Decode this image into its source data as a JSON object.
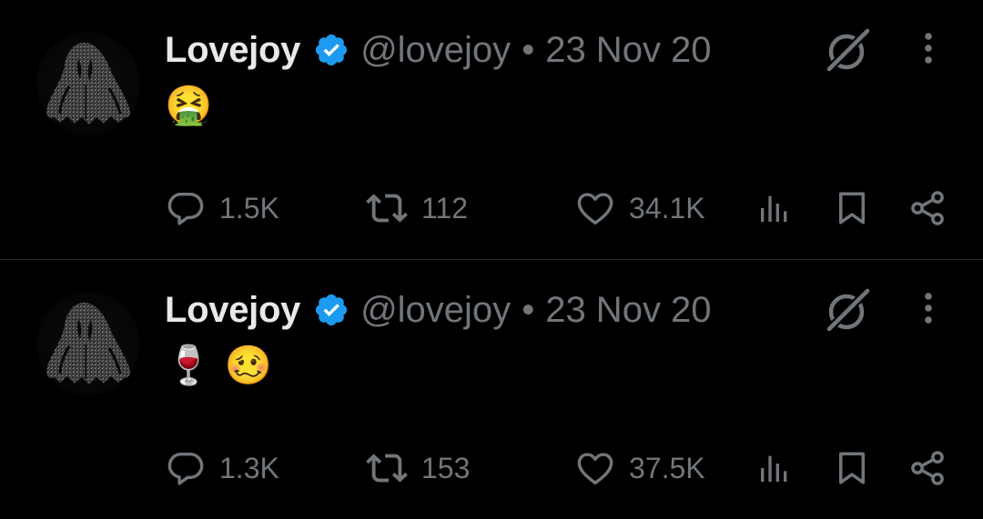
{
  "colors": {
    "background": "#000000",
    "primary_text": "#e7e9ea",
    "secondary_text": "#71767b",
    "verified_badge": "#1d9bf0",
    "divider": "#2f3336"
  },
  "tweets": [
    {
      "author": {
        "display_name": "Lovejoy",
        "handle": "@lovejoy",
        "verified": true
      },
      "separator": "•",
      "date": "23 Nov 20",
      "text": "🤮",
      "actions": {
        "replies": "1.5K",
        "retweets": "112",
        "likes": "34.1K"
      },
      "icons": {
        "reply": "reply-icon",
        "retweet": "retweet-icon",
        "like": "heart-icon",
        "views": "views-icon",
        "bookmark": "bookmark-icon",
        "share": "share-icon",
        "grok": "grok-icon",
        "more": "more-icon"
      }
    },
    {
      "author": {
        "display_name": "Lovejoy",
        "handle": "@lovejoy",
        "verified": true
      },
      "separator": "•",
      "date": "23 Nov 20",
      "text": "🍷 🥴",
      "actions": {
        "replies": "1.3K",
        "retweets": "153",
        "likes": "37.5K"
      },
      "icons": {
        "reply": "reply-icon",
        "retweet": "retweet-icon",
        "like": "heart-icon",
        "views": "views-icon",
        "bookmark": "bookmark-icon",
        "share": "share-icon",
        "grok": "grok-icon",
        "more": "more-icon"
      }
    }
  ]
}
